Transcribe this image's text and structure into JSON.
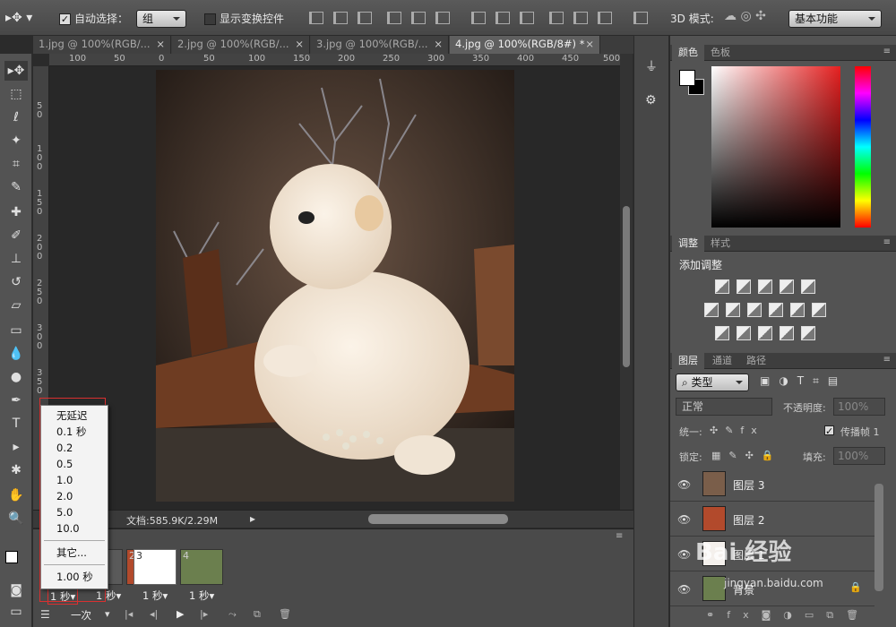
{
  "options": {
    "auto_select_label": "自动选择：",
    "auto_select_value": "组",
    "show_transform_label": "显示变换控件",
    "mode_3d_label": "3D 模式:",
    "workspace_value": "基本功能"
  },
  "tabs": [
    {
      "label": "1.jpg @ 100%(RGB/...",
      "close": "×"
    },
    {
      "label": "2.jpg @ 100%(RGB/...",
      "close": "×"
    },
    {
      "label": "3.jpg @ 100%(RGB/...",
      "close": "×"
    },
    {
      "label": "4.jpg @ 100%(RGB/8#) *",
      "close": "×"
    }
  ],
  "ruler_h": [
    "100",
    "50",
    "0",
    "50",
    "100",
    "150",
    "200",
    "250",
    "300",
    "350",
    "400",
    "450",
    "500"
  ],
  "ruler_v": [
    "5 0",
    "1 0 0",
    "1 5 0",
    "2 0 0",
    "2 5 0",
    "3 0 0",
    "3 5 0"
  ],
  "status": {
    "doc": "文档:585.9K/2.29M"
  },
  "delay_menu": {
    "items": [
      "无延迟",
      "0.1 秒",
      "0.2",
      "0.5",
      "1.0",
      "2.0",
      "5.0",
      "10.0"
    ],
    "other": "其它...",
    "current": "1.00 秒"
  },
  "timeline": {
    "frames": [
      {
        "num": "1",
        "delay": "1 秒▾"
      },
      {
        "num": "2",
        "delay": "1 秒▾"
      },
      {
        "num": "3",
        "delay": "1 秒▾"
      },
      {
        "num": "4",
        "delay": "1 秒▾"
      }
    ],
    "loop": "一次"
  },
  "panels": {
    "color_tabs": [
      "颜色",
      "色板"
    ],
    "adjust_tabs": [
      "调整",
      "样式"
    ],
    "adjust_title": "添加调整",
    "layer_tabs": [
      "图层",
      "通道",
      "路径"
    ],
    "kind": "类型",
    "blend": "正常",
    "opacity_label": "不透明度:",
    "opacity_value": "100%",
    "unify_label": "统一:",
    "propagate_label": "传播帧 1",
    "lock_label": "锁定:",
    "fill_label": "填充:",
    "fill_value": "100%",
    "layers": [
      "图层 3",
      "图层 2",
      "图层 1",
      "背景"
    ]
  },
  "watermark": {
    "brand": "Bai 经验",
    "url": "jingyan.baidu.com"
  },
  "colors": {
    "accent_red": "#d93030",
    "panel": "#535353"
  }
}
